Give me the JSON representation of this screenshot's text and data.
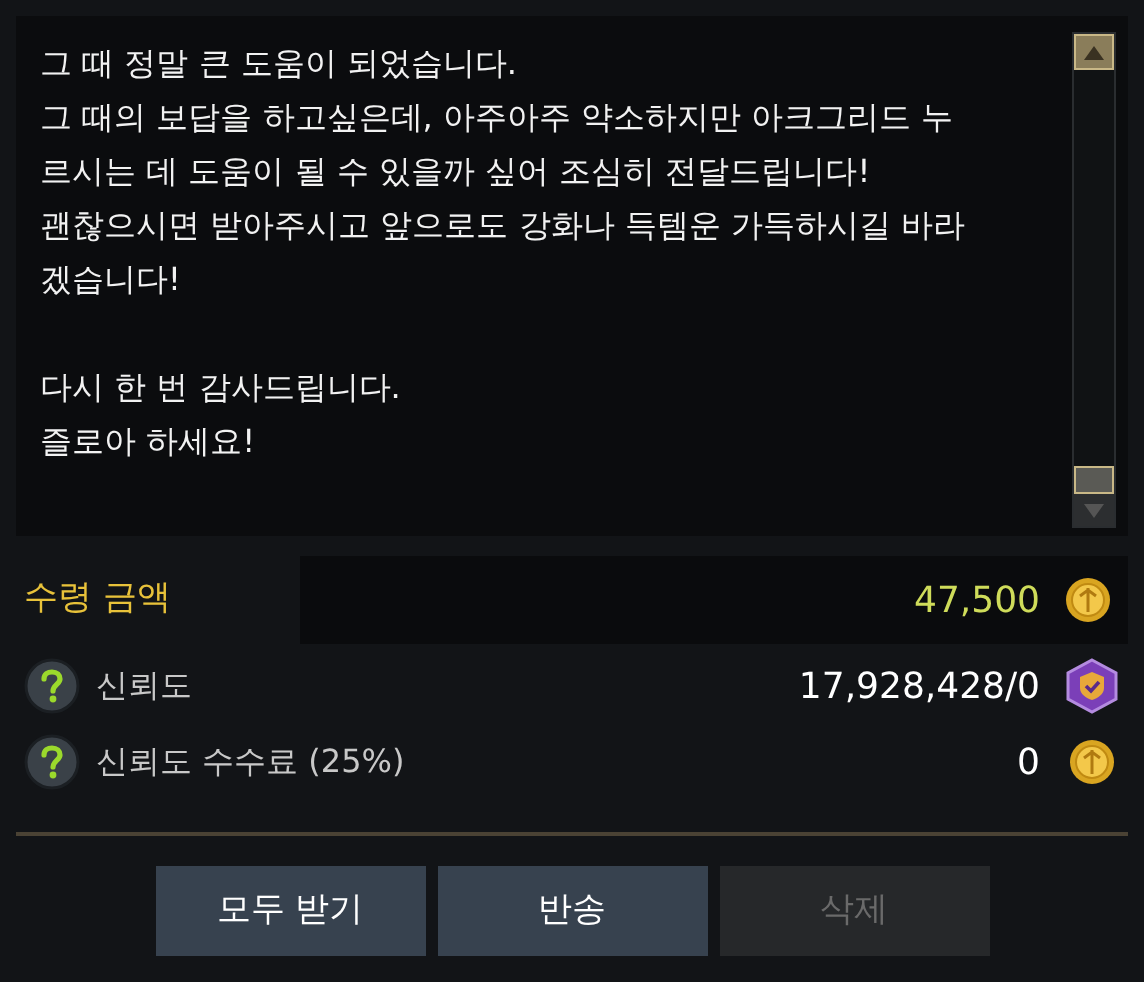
{
  "message": {
    "paragraphs": [
      [
        "그 때 정말 큰 도움이 되었습니다.",
        "그 때의 보답을 하고싶은데, 아주아주 약소하지만 아크그리드 누",
        "르시는 데 도움이 될 수 있을까 싶어 조심히 전달드립니다!",
        "괜찮으시면 받아주시고 앞으로도 강화나 득템운 가득하시길 바라",
        "겠습니다!"
      ],
      [
        "다시 한 번 감사드립니다.",
        "즐로아 하세요!"
      ]
    ]
  },
  "amount": {
    "label": "수령 금액",
    "value": "47,500"
  },
  "rows": [
    {
      "label": "신뢰도",
      "value": "17,928,428/0",
      "kind": "trust"
    },
    {
      "label": "신뢰도 수수료 (25%)",
      "value": "0",
      "kind": "gold"
    }
  ],
  "buttons": [
    {
      "label": "모두 받기",
      "disabled": false
    },
    {
      "label": "반송",
      "disabled": false
    },
    {
      "label": "삭제",
      "disabled": true
    }
  ]
}
